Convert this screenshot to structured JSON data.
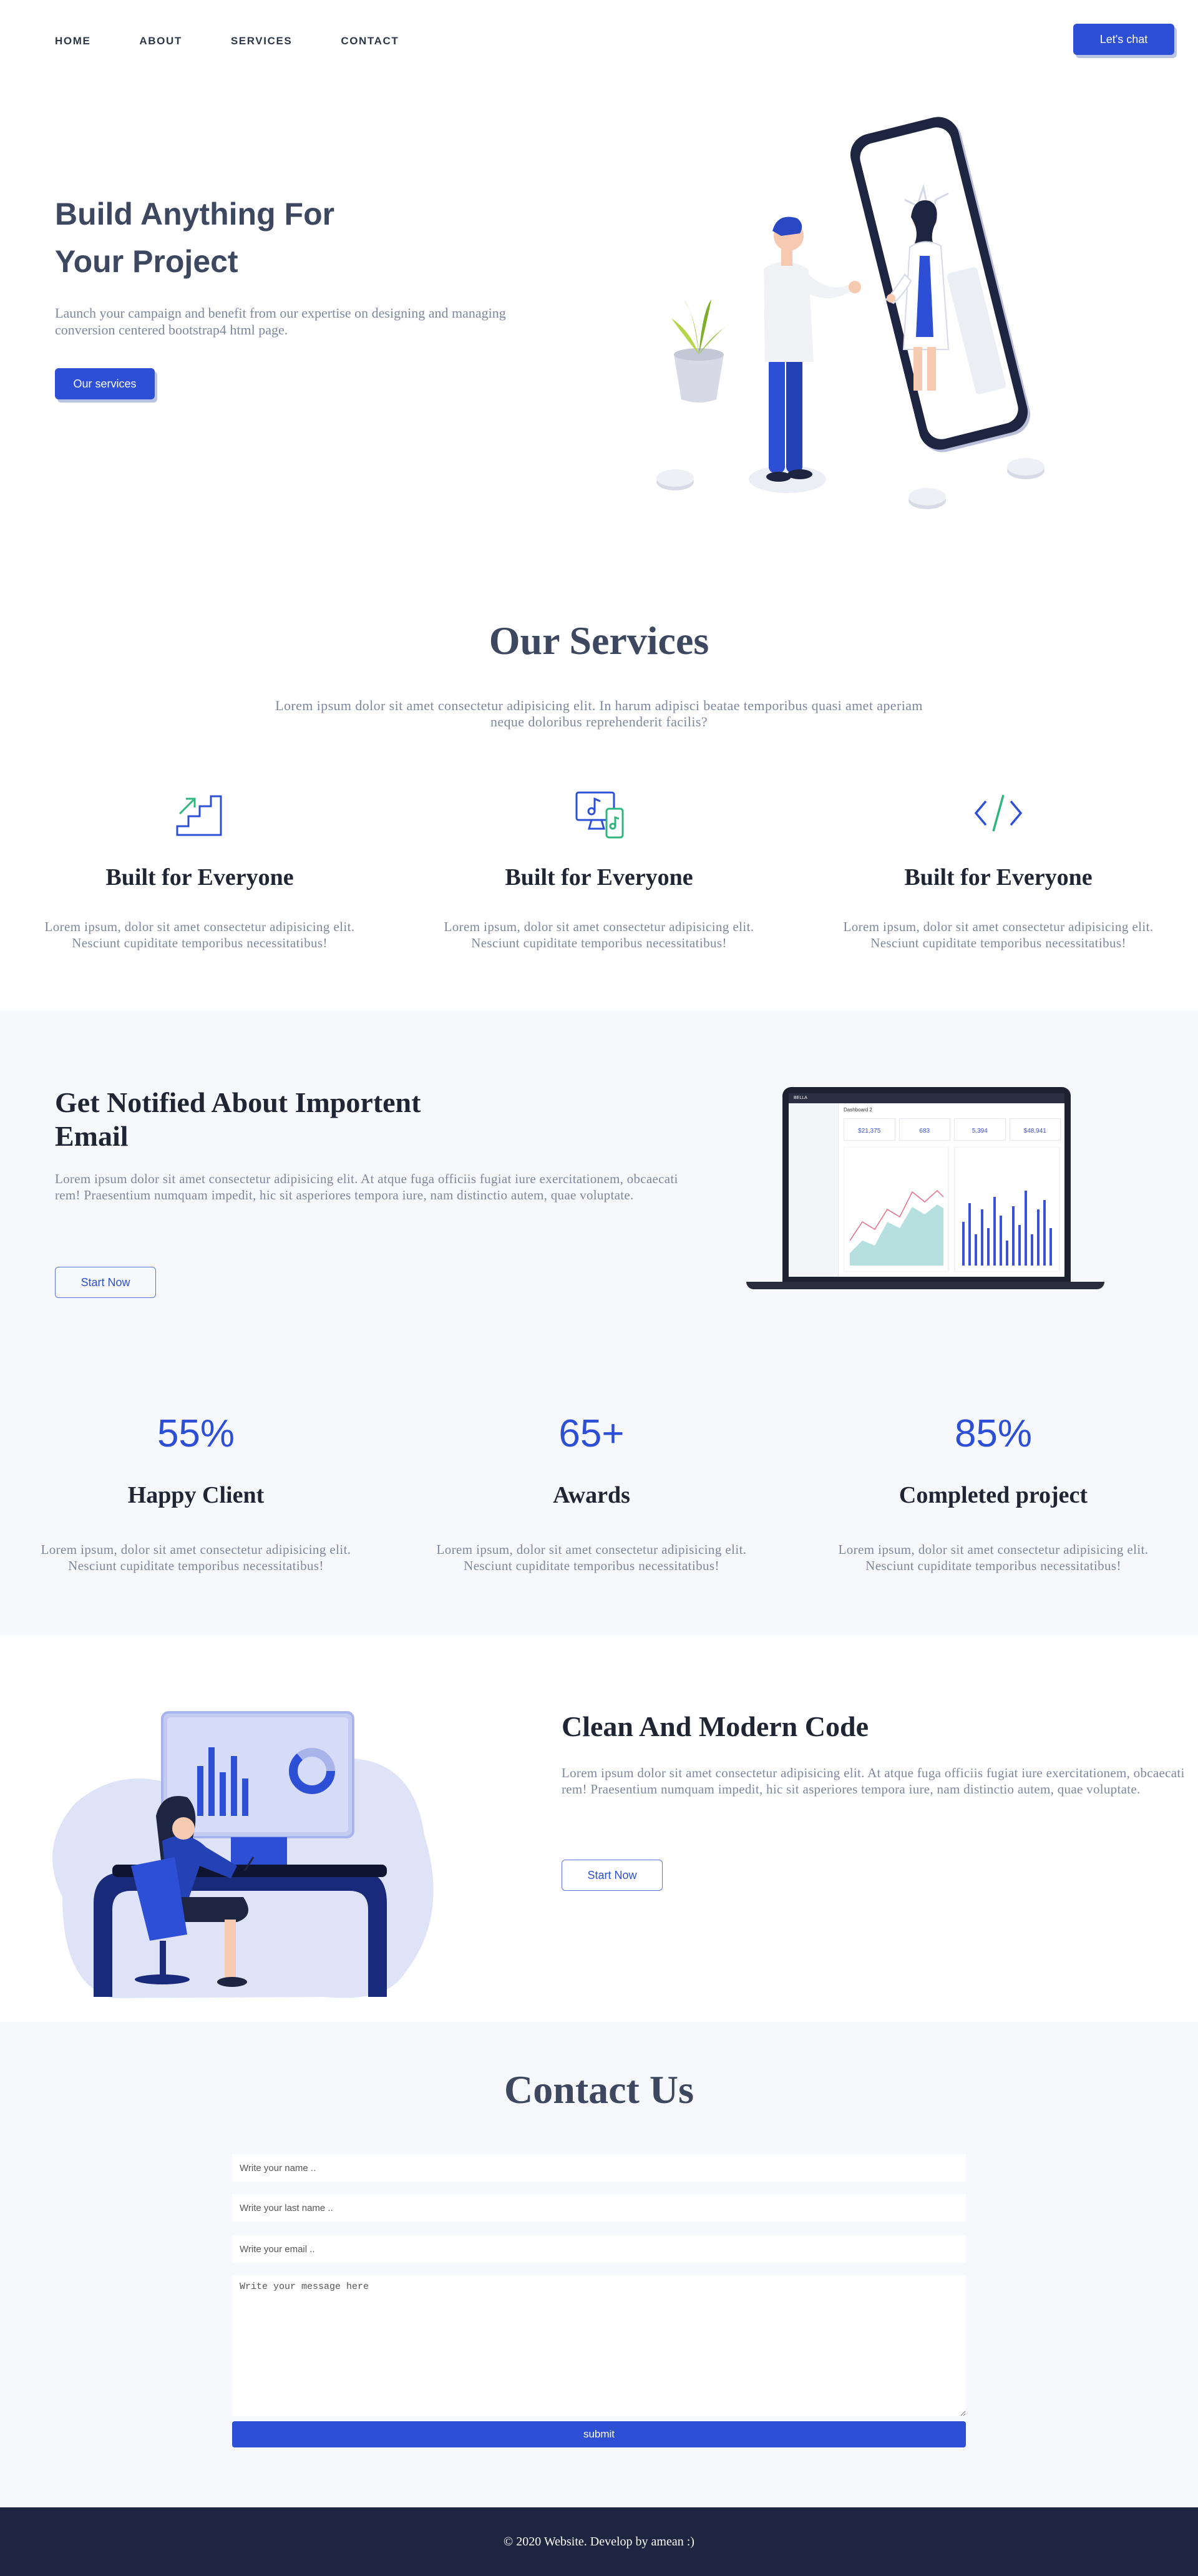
{
  "nav": {
    "links": [
      "HOME",
      "ABOUT",
      "SERVICES",
      "CONTACT"
    ],
    "cta": "Let's chat"
  },
  "hero": {
    "title_line1": "Build Anything For",
    "title_line2": "Your Project",
    "text": "Launch your campaign and benefit from our expertise on designing and managing conversion centered bootstrap4 html page.",
    "button": "Our services"
  },
  "services": {
    "title": "Our Services",
    "subtitle": "Lorem ipsum dolor sit amet consectetur adipisicing elit. In harum adipisci beatae temporibus quasi amet aperiam neque doloribus reprehenderit facilis?",
    "items": [
      {
        "icon": "stairs-growth-icon",
        "title": "Built for Everyone",
        "text": "Lorem ipsum, dolor sit amet consectetur adipisicing elit. Nesciunt cupiditate temporibus necessitatibus!"
      },
      {
        "icon": "monitor-music-icon",
        "title": "Built for Everyone",
        "text": "Lorem ipsum, dolor sit amet consectetur adipisicing elit. Nesciunt cupiditate temporibus necessitatibus!"
      },
      {
        "icon": "code-icon",
        "title": "Built for Everyone",
        "text": "Lorem ipsum, dolor sit amet consectetur adipisicing elit. Nesciunt cupiditate temporibus necessitatibus!"
      }
    ]
  },
  "notify": {
    "title": "Get Notified About Importent Email",
    "text": "Lorem ipsum dolor sit amet consectetur adipisicing elit. At atque fuga officiis fugiat iure exercitationem, obcaecati rem! Praesentium numquam impedit, hic sit asperiores tempora iure, nam distinctio autem, quae voluptate.",
    "button": "Start Now",
    "laptop": {
      "app_name": "BELLA",
      "page_title": "Dashboard 2",
      "stats": [
        "$21,375",
        "683",
        "5,394",
        "$48,941"
      ]
    }
  },
  "stats": [
    {
      "value": "55%",
      "title": "Happy Client",
      "text": "Lorem ipsum, dolor sit amet consectetur adipisicing elit. Nesciunt cupiditate temporibus necessitatibus!"
    },
    {
      "value": "65+",
      "title": "Awards",
      "text": "Lorem ipsum, dolor sit amet consectetur adipisicing elit. Nesciunt cupiditate temporibus necessitatibus!"
    },
    {
      "value": "85%",
      "title": "Completed project",
      "text": "Lorem ipsum, dolor sit amet consectetur adipisicing elit. Nesciunt cupiditate temporibus necessitatibus!"
    }
  ],
  "code": {
    "title": "Clean And Modern Code",
    "text": "Lorem ipsum dolor sit amet consectetur adipisicing elit. At atque fuga officiis fugiat iure exercitationem, obcaecati rem! Praesentium numquam impedit, hic sit asperiores tempora iure, nam distinctio autem, quae voluptate.",
    "button": "Start Now"
  },
  "contact": {
    "title": "Contact Us",
    "name_placeholder": "Write your name ..",
    "last_name_placeholder": "Write your last name ..",
    "email_placeholder": "Write your email ..",
    "message_placeholder": "Write your message here",
    "submit": "submit"
  },
  "footer": {
    "text": "© 2020 Website. Develop by amean :)"
  },
  "colors": {
    "primary": "#2d4fd6",
    "heading": "#3d4860",
    "muted": "#7e879c",
    "section_bg": "#f7f8fc",
    "footer_bg": "#1e2540",
    "icon_green": "#2fb57e"
  }
}
